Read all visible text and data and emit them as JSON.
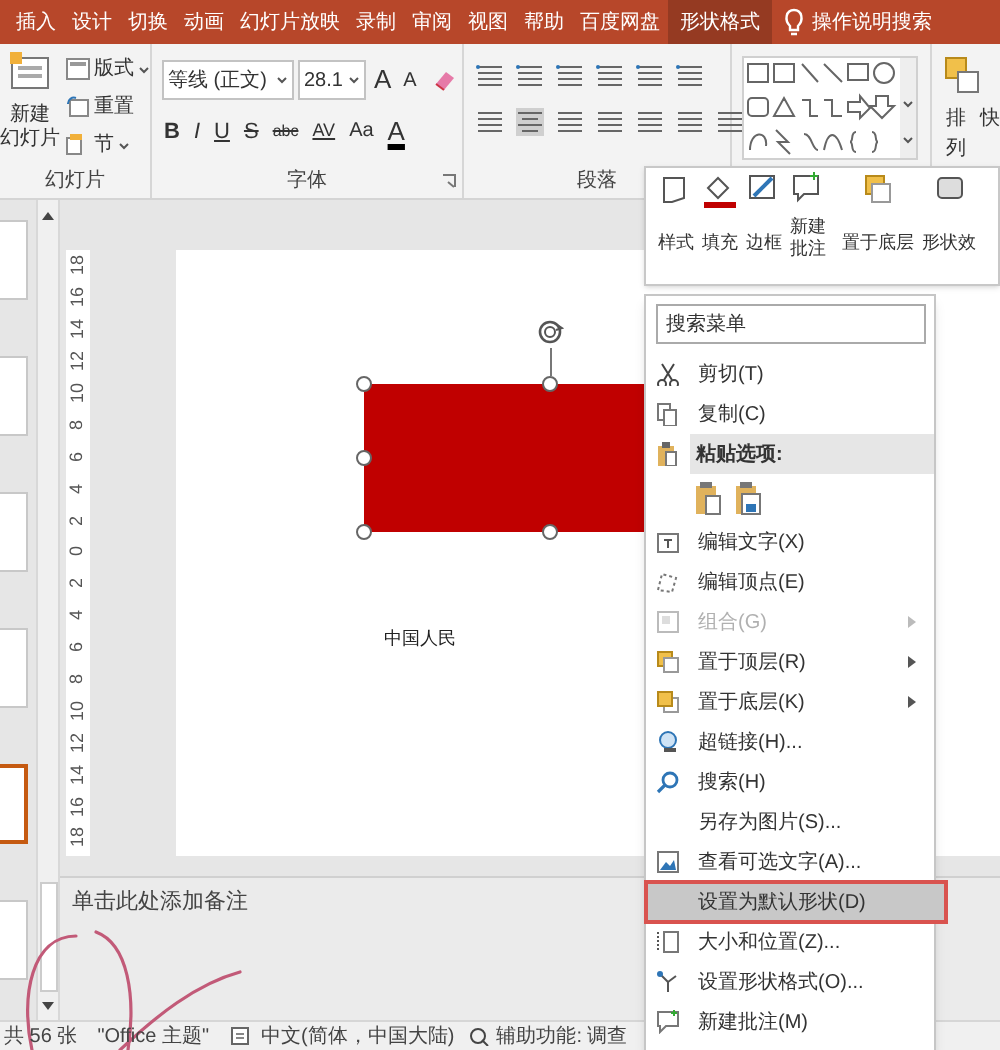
{
  "tabs": [
    {
      "label": "插入",
      "selected": false
    },
    {
      "label": "设计",
      "selected": false
    },
    {
      "label": "切换",
      "selected": false
    },
    {
      "label": "动画",
      "selected": false
    },
    {
      "label": "幻灯片放映",
      "selected": false
    },
    {
      "label": "录制",
      "selected": false
    },
    {
      "label": "审阅",
      "selected": false
    },
    {
      "label": "视图",
      "selected": false
    },
    {
      "label": "帮助",
      "selected": false
    },
    {
      "label": "百度网盘",
      "selected": false
    },
    {
      "label": "形状格式",
      "selected": true
    }
  ],
  "tell_me": "操作说明搜索",
  "ribbon": {
    "slides_group": {
      "label": "幻灯片",
      "new_slide": [
        "新建",
        "幻灯片"
      ],
      "items": [
        "版式",
        "重置",
        "节"
      ]
    },
    "font_group": {
      "label": "字体",
      "font_name": "等线 (正文)",
      "font_size": "28.1",
      "size_buttons": [
        "A",
        "A"
      ],
      "format_buttons": [
        "B",
        "I",
        "U",
        "S",
        "abc",
        "AV",
        "Aa",
        "A"
      ]
    },
    "paragraph_group": {
      "label": "段落"
    },
    "arrange": "排列",
    "next_group": "快"
  },
  "mini_toolbar": [
    {
      "lines": [
        "样式"
      ]
    },
    {
      "lines": [
        "填充"
      ]
    },
    {
      "lines": [
        "边框"
      ]
    },
    {
      "lines": [
        "新建",
        "批注"
      ]
    },
    {
      "lines": [
        "置于底层"
      ]
    },
    {
      "lines": [
        "形状效"
      ]
    }
  ],
  "thumbnails": [
    {
      "selected": false
    },
    {
      "selected": false
    },
    {
      "selected": false
    },
    {
      "selected": false
    },
    {
      "selected": true
    },
    {
      "selected": false
    }
  ],
  "vertical_ruler": [
    "18",
    "16",
    "14",
    "12",
    "10",
    "8",
    "6",
    "4",
    "2",
    "0",
    "2",
    "4",
    "6",
    "8",
    "10",
    "12",
    "14",
    "16",
    "18"
  ],
  "slide": {
    "text": "中国人民"
  },
  "notes": {
    "placeholder": "单击此处添加备注"
  },
  "status_bar": [
    "共 56 张",
    "\"Office 主题\"",
    "中文(简体，中国大陆)",
    "辅助功能: 调查"
  ],
  "context_menu": {
    "search": {
      "placeholder": "搜索菜单"
    },
    "items": [
      {
        "kind": "command",
        "label": "剪切(T)",
        "disabled": false,
        "submenu": false,
        "selected": false
      },
      {
        "kind": "command",
        "label": "复制(C)",
        "disabled": false,
        "submenu": false,
        "selected": false
      },
      {
        "kind": "header",
        "label": "粘贴选项:"
      },
      {
        "kind": "paste_options"
      },
      {
        "kind": "command",
        "label": "编辑文字(X)",
        "disabled": false,
        "submenu": false,
        "selected": false
      },
      {
        "kind": "command",
        "label": "编辑顶点(E)",
        "disabled": false,
        "submenu": false,
        "selected": false
      },
      {
        "kind": "command",
        "label": "组合(G)",
        "disabled": true,
        "submenu": true,
        "selected": false
      },
      {
        "kind": "command",
        "label": "置于顶层(R)",
        "disabled": false,
        "submenu": true,
        "selected": false
      },
      {
        "kind": "command",
        "label": "置于底层(K)",
        "disabled": false,
        "submenu": true,
        "selected": false
      },
      {
        "kind": "command",
        "label": "超链接(H)...",
        "disabled": false,
        "submenu": false,
        "selected": false
      },
      {
        "kind": "command",
        "label": "搜索(H)",
        "disabled": false,
        "submenu": false,
        "selected": false
      },
      {
        "kind": "command",
        "label": "另存为图片(S)...",
        "disabled": false,
        "submenu": false,
        "selected": false
      },
      {
        "kind": "command",
        "label": "查看可选文字(A)...",
        "disabled": false,
        "submenu": false,
        "selected": false
      },
      {
        "kind": "command",
        "label": "设置为默认形状(D)",
        "disabled": false,
        "submenu": false,
        "selected": true
      },
      {
        "kind": "command",
        "label": "大小和位置(Z)...",
        "disabled": false,
        "submenu": false,
        "selected": false
      },
      {
        "kind": "command",
        "label": "设置形状格式(O)...",
        "disabled": false,
        "submenu": false,
        "selected": false
      },
      {
        "kind": "command",
        "label": "新建批注(M)",
        "disabled": false,
        "submenu": false,
        "selected": false
      }
    ]
  }
}
